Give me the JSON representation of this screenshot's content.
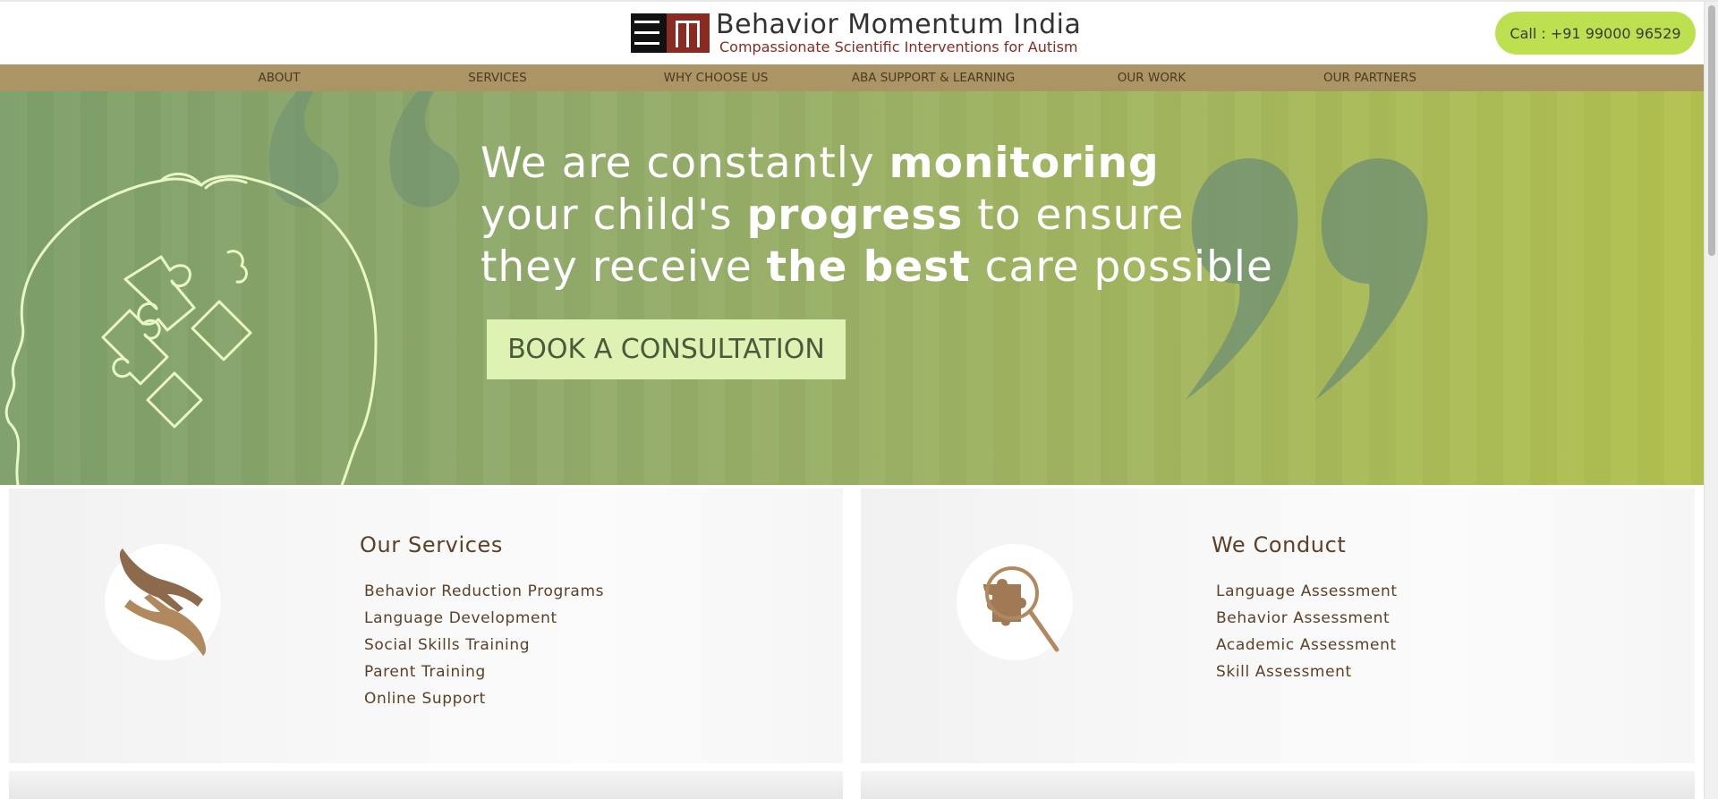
{
  "header": {
    "brand_title": "Behavior Momentum India",
    "tagline": "Compassionate Scientific Interventions for Autism",
    "call_label": "Call : +91 99000 96529"
  },
  "nav": {
    "items": [
      {
        "label": "ABOUT"
      },
      {
        "label": "SERVICES"
      },
      {
        "label": "WHY CHOOSE US"
      },
      {
        "label": "ABA SUPPORT & LEARNING"
      },
      {
        "label": "OUR WORK"
      },
      {
        "label": "OUR PARTNERS"
      }
    ]
  },
  "hero": {
    "line1_a": "We are constantly ",
    "line1_b": "monitoring",
    "line2_a": "your child's ",
    "line2_b": "progress",
    "line2_c": " to ensure",
    "line3_a": "they receive ",
    "line3_b": "the best",
    "line3_c": " care possible",
    "cta_label": "BOOK A CONSULTATION"
  },
  "services_card": {
    "title": "Our Services",
    "items": [
      "Behavior Reduction Programs",
      "Language Development",
      "Social Skills Training",
      "Parent Training",
      "Online Support"
    ]
  },
  "conduct_card": {
    "title": "We Conduct",
    "items": [
      "Language Assessment",
      "Behavior Assessment",
      "Academic Assessment",
      "Skill Assessment"
    ]
  },
  "colors": {
    "accent_green": "#bde051",
    "nav_tan": "#ab9565",
    "brand_red": "#8b2a22",
    "cta_bg": "#def2b4",
    "text_brown": "#5a4128"
  },
  "icons": {
    "logo": "bmi-logo-icon",
    "hero_head": "head-puzzle-icon",
    "services": "caring-hands-icon",
    "conduct": "puzzle-magnifier-icon"
  }
}
